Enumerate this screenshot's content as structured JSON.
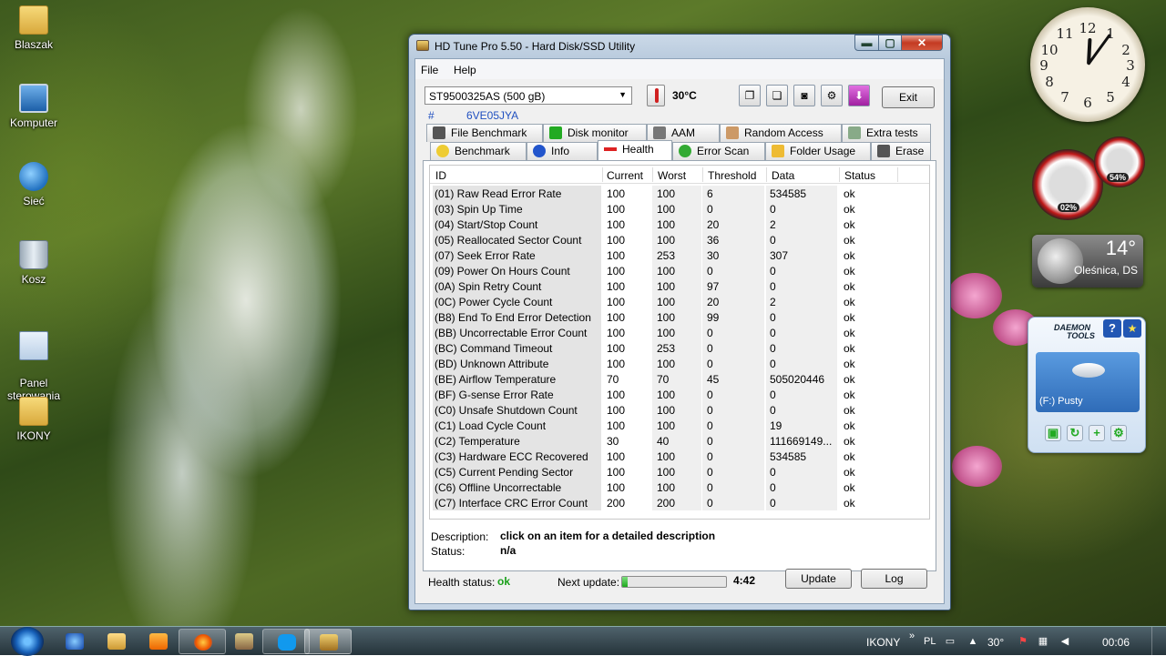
{
  "desktop": {
    "icons": [
      {
        "label": "Blaszak"
      },
      {
        "label": "Komputer"
      },
      {
        "label": "Sieć"
      },
      {
        "label": "Kosz"
      },
      {
        "label": "Panel\nsterowania"
      },
      {
        "label": "IKONY"
      }
    ]
  },
  "gadgets": {
    "clock": {
      "numbers": [
        "12",
        "1",
        "2",
        "3",
        "4",
        "5",
        "6",
        "7",
        "8",
        "9",
        "10",
        "11"
      ],
      "time": "00:06"
    },
    "meters": {
      "cpu": "02%",
      "memory": "54%"
    },
    "weather": {
      "temp": "14°",
      "city": "Oleśnica, DS"
    },
    "daemon": {
      "brand_line1": "DAEMON",
      "brand_line2": "TOOLS",
      "help": "?",
      "drive_label": "(F:) Pusty"
    }
  },
  "window": {
    "title": "HD Tune Pro 5.50 - Hard Disk/SSD Utility",
    "controls": {
      "minimize": "▬",
      "maximize": "▢",
      "close": "✕"
    },
    "menu": {
      "file": "File",
      "help": "Help"
    },
    "toolbar": {
      "drive": "ST9500325AS (500 gB)",
      "serial_hash": "#",
      "serial": "6VE05JYA",
      "temperature": "30°C",
      "exit": "Exit"
    },
    "tabs_row1": [
      "File Benchmark",
      "Disk monitor",
      "AAM",
      "Random Access",
      "Extra tests"
    ],
    "tabs_row2": [
      "Benchmark",
      "Info",
      "Health",
      "Error Scan",
      "Folder Usage",
      "Erase"
    ],
    "active_tab": "Health",
    "health": {
      "columns": [
        "ID",
        "Current",
        "Worst",
        "Threshold",
        "Data",
        "Status"
      ],
      "rows": [
        [
          "(01) Raw Read Error Rate",
          "100",
          "100",
          "6",
          "534585",
          "ok"
        ],
        [
          "(03) Spin Up Time",
          "100",
          "100",
          "0",
          "0",
          "ok"
        ],
        [
          "(04) Start/Stop Count",
          "100",
          "100",
          "20",
          "2",
          "ok"
        ],
        [
          "(05) Reallocated Sector Count",
          "100",
          "100",
          "36",
          "0",
          "ok"
        ],
        [
          "(07) Seek Error Rate",
          "100",
          "253",
          "30",
          "307",
          "ok"
        ],
        [
          "(09) Power On Hours Count",
          "100",
          "100",
          "0",
          "0",
          "ok"
        ],
        [
          "(0A) Spin Retry Count",
          "100",
          "100",
          "97",
          "0",
          "ok"
        ],
        [
          "(0C) Power Cycle Count",
          "100",
          "100",
          "20",
          "2",
          "ok"
        ],
        [
          "(B8) End To End Error Detection",
          "100",
          "100",
          "99",
          "0",
          "ok"
        ],
        [
          "(BB) Uncorrectable Error Count",
          "100",
          "100",
          "0",
          "0",
          "ok"
        ],
        [
          "(BC) Command Timeout",
          "100",
          "253",
          "0",
          "0",
          "ok"
        ],
        [
          "(BD) Unknown Attribute",
          "100",
          "100",
          "0",
          "0",
          "ok"
        ],
        [
          "(BE) Airflow Temperature",
          "70",
          "70",
          "45",
          "505020446",
          "ok"
        ],
        [
          "(BF) G-sense Error Rate",
          "100",
          "100",
          "0",
          "0",
          "ok"
        ],
        [
          "(C0) Unsafe Shutdown Count",
          "100",
          "100",
          "0",
          "0",
          "ok"
        ],
        [
          "(C1) Load Cycle Count",
          "100",
          "100",
          "0",
          "19",
          "ok"
        ],
        [
          "(C2) Temperature",
          "30",
          "40",
          "0",
          "111669149...",
          "ok"
        ],
        [
          "(C3) Hardware ECC Recovered",
          "100",
          "100",
          "0",
          "534585",
          "ok"
        ],
        [
          "(C5) Current Pending Sector",
          "100",
          "100",
          "0",
          "0",
          "ok"
        ],
        [
          "(C6) Offline Uncorrectable",
          "100",
          "100",
          "0",
          "0",
          "ok"
        ],
        [
          "(C7) Interface CRC Error Count",
          "200",
          "200",
          "0",
          "0",
          "ok"
        ]
      ],
      "description_label": "Description:",
      "description": "click on an item for a detailed description",
      "status_label": "Status:",
      "status": "n/a",
      "health_status_label": "Health status:",
      "health_status": "ok",
      "next_update_label": "Next update:",
      "next_update_progress": 0.05,
      "next_update_time": "4:42",
      "update_button": "Update",
      "log_button": "Log"
    }
  },
  "taskbar": {
    "tray_label": "IKONY",
    "lang": "PL",
    "temp": "30°",
    "time": "00:06"
  },
  "colors": {
    "health_ok": "#19a019",
    "link_blue": "#2050c0",
    "close_red": "#c43a22"
  }
}
